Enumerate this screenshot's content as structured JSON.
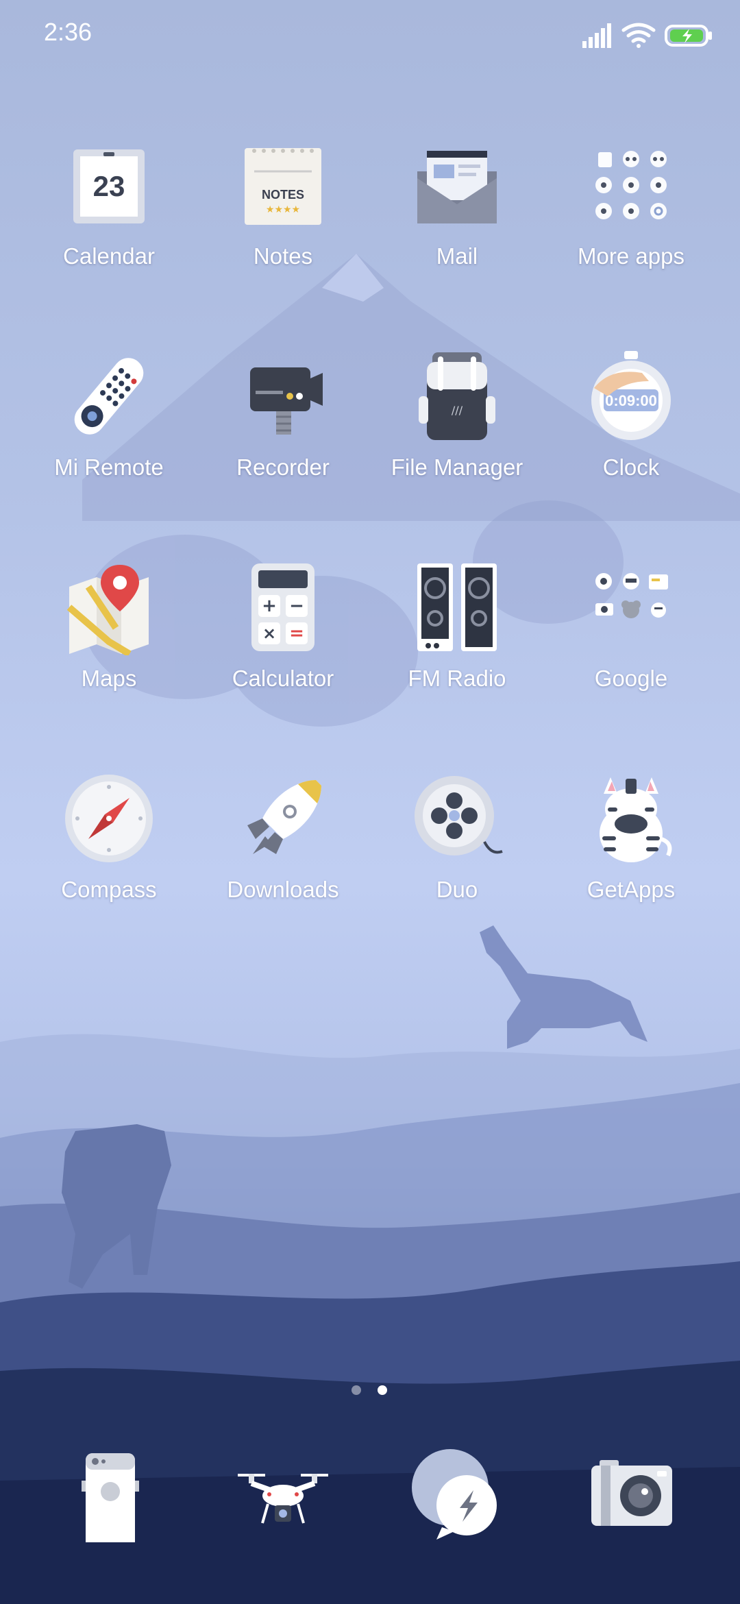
{
  "status_bar": {
    "time": "2:36"
  },
  "apps": [
    {
      "label": "Calendar",
      "icon": "calendar-icon",
      "date": "23"
    },
    {
      "label": "Notes",
      "icon": "notes-icon",
      "badge": "NOTES"
    },
    {
      "label": "Mail",
      "icon": "mail-icon"
    },
    {
      "label": "More apps",
      "icon": "more-apps-folder-icon"
    },
    {
      "label": "Mi Remote",
      "icon": "mi-remote-icon"
    },
    {
      "label": "Recorder",
      "icon": "recorder-icon"
    },
    {
      "label": "File Manager",
      "icon": "file-manager-icon"
    },
    {
      "label": "Clock",
      "icon": "clock-icon",
      "time": "0:09:00"
    },
    {
      "label": "Maps",
      "icon": "maps-icon"
    },
    {
      "label": "Calculator",
      "icon": "calculator-icon"
    },
    {
      "label": "FM Radio",
      "icon": "fm-radio-icon"
    },
    {
      "label": "Google",
      "icon": "google-folder-icon"
    },
    {
      "label": "Compass",
      "icon": "compass-icon"
    },
    {
      "label": "Downloads",
      "icon": "downloads-icon"
    },
    {
      "label": "Duo",
      "icon": "duo-icon"
    },
    {
      "label": "GetApps",
      "icon": "getapps-icon"
    }
  ],
  "page_indicator": {
    "pages": 2,
    "active": 2
  },
  "dock": [
    {
      "icon": "phone-icon"
    },
    {
      "icon": "drone-icon"
    },
    {
      "icon": "messaging-icon"
    },
    {
      "icon": "camera-icon"
    }
  ]
}
